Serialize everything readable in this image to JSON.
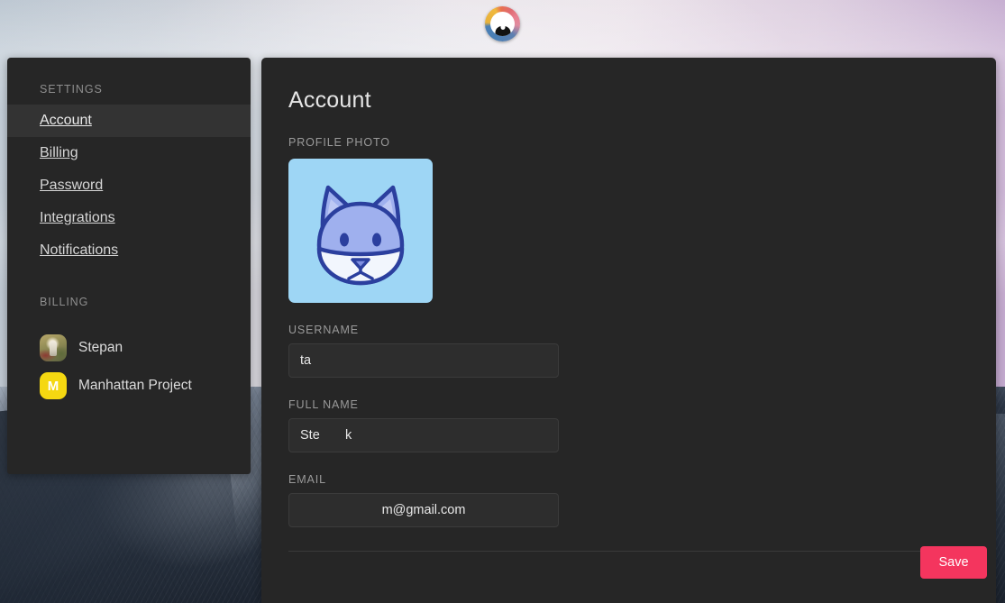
{
  "app": {
    "icon_name": "browser-app-icon"
  },
  "sidebar": {
    "sections": [
      {
        "label": "SETTINGS"
      },
      {
        "label": "BILLING"
      }
    ],
    "nav_items": [
      {
        "label": "Account",
        "active": true
      },
      {
        "label": "Billing",
        "active": false
      },
      {
        "label": "Password",
        "active": false
      },
      {
        "label": "Integrations",
        "active": false
      },
      {
        "label": "Notifications",
        "active": false
      }
    ],
    "accounts": [
      {
        "name": "Stepan",
        "avatar_type": "photo",
        "initial": ""
      },
      {
        "name": "Manhattan Project",
        "avatar_type": "letter",
        "initial": "M"
      }
    ]
  },
  "main": {
    "title": "Account",
    "profile_photo": {
      "label": "PROFILE PHOTO",
      "icon_name": "fox-avatar",
      "background_color": "#9ed6f5",
      "fill_color": "#9fb0ee",
      "stroke_color": "#2b3f9e",
      "muzzle_color": "#f2f6fd"
    },
    "fields": [
      {
        "key": "username",
        "label": "USERNAME",
        "value": "ta",
        "placeholder": ""
      },
      {
        "key": "full_name",
        "label": "FULL NAME",
        "value": "Ste       k",
        "placeholder": ""
      },
      {
        "key": "email",
        "label": "EMAIL",
        "value": "m@gmail.com",
        "placeholder": ""
      }
    ],
    "save_label": "Save",
    "accent_color": "#f4355e"
  }
}
